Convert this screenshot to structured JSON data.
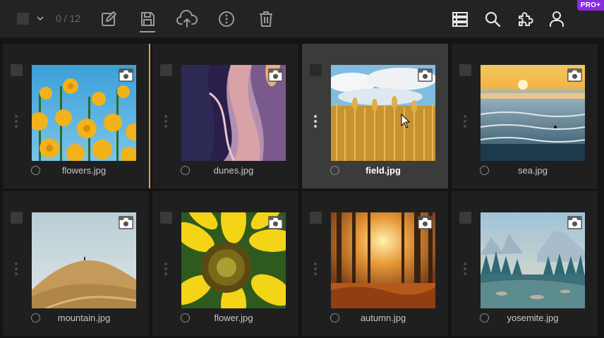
{
  "toolbar": {
    "selection_count": "0 / 12",
    "pro_badge": "PRO+",
    "icons": [
      "checkbox",
      "chevron-down-icon",
      "edit-icon",
      "save-icon",
      "cloud-upload-icon",
      "info-icon",
      "trash-icon",
      "list-view-icon",
      "search-icon",
      "plugin-icon",
      "user-icon"
    ]
  },
  "colors": {
    "accent": "#e8a13a",
    "pro": "#8a2be2",
    "background": "#141414",
    "card": "#1f1f1f",
    "card_selected": "#3b3b3b"
  },
  "files": [
    {
      "name": "flowers.jpg"
    },
    {
      "name": "dunes.jpg"
    },
    {
      "name": "field.jpg"
    },
    {
      "name": "sea.jpg"
    },
    {
      "name": "mountain.jpg"
    },
    {
      "name": "flower.jpg"
    },
    {
      "name": "autumn.jpg"
    },
    {
      "name": "yosemite.jpg"
    }
  ]
}
